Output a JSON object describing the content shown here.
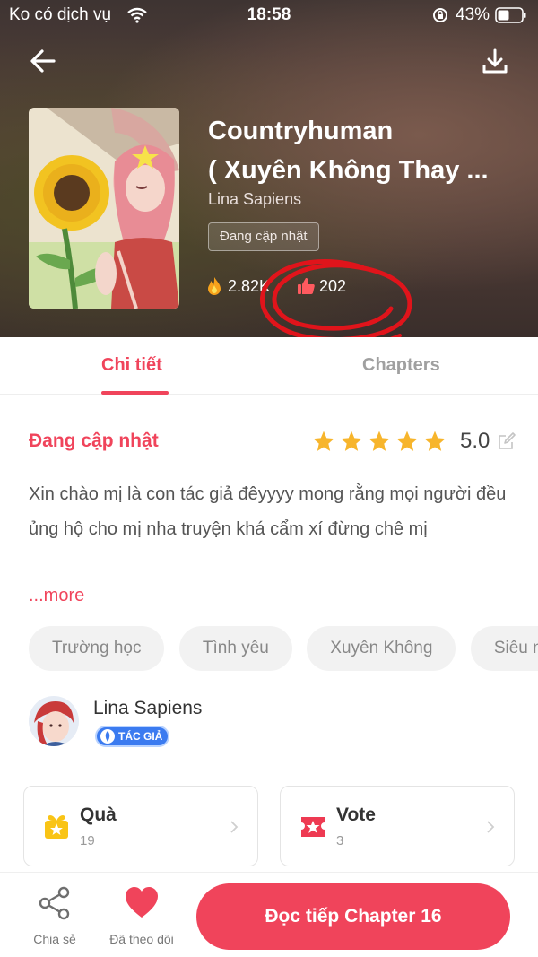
{
  "status_bar": {
    "carrier": "Ko có dịch vụ",
    "time": "18:58",
    "battery": "43%"
  },
  "book": {
    "title": "Countryhuman ( Xuyên Không Thay ...",
    "title_line1": "Countryhuman",
    "title_line2": "( Xuyên Không Thay ...",
    "author": "Lina Sapiens",
    "status_chip": "Đang cập nhật",
    "reads": "2.82K",
    "likes": "202"
  },
  "tabs": [
    {
      "label": "Chi tiết",
      "active": true
    },
    {
      "label": "Chapters",
      "active": false
    }
  ],
  "detail": {
    "status": "Đang cập nhật",
    "rating": 5.0,
    "rating_text": "5.0",
    "stars": 5,
    "description": "Xin chào mị là con tác giả đêyyyy mong rằng mọi người đều ủng hộ cho mị nha truyện khá cẩm xí đừng chê mị",
    "more": "...more",
    "tags": [
      "Trường học",
      "Tình yêu",
      "Xuyên Không",
      "Siêu n"
    ]
  },
  "author": {
    "name": "Lina Sapiens",
    "badge": "TÁC GIẢ"
  },
  "cards": {
    "gift": {
      "label": "Quà",
      "count": "19"
    },
    "vote": {
      "label": "Vote",
      "count": "3"
    }
  },
  "bottom_bar": {
    "share_label": "Chia sẻ",
    "follow_label": "Đã theo dõi",
    "read_button": "Đọc tiếp Chapter 16"
  },
  "colors": {
    "accent": "#f0445b",
    "star": "#f7b52c",
    "gift_icon": "#f9c416",
    "vote_icon": "#ee3a52",
    "badge": "#3b7bf0",
    "annotation": "#e0141b"
  },
  "icons": {
    "back": "arrow-left-icon",
    "download": "download-icon",
    "reads": "fire-icon",
    "likes": "thumbs-up-icon",
    "share": "share-icon",
    "follow": "heart-icon",
    "gift": "gift-icon",
    "vote": "vote-ticket-icon"
  }
}
